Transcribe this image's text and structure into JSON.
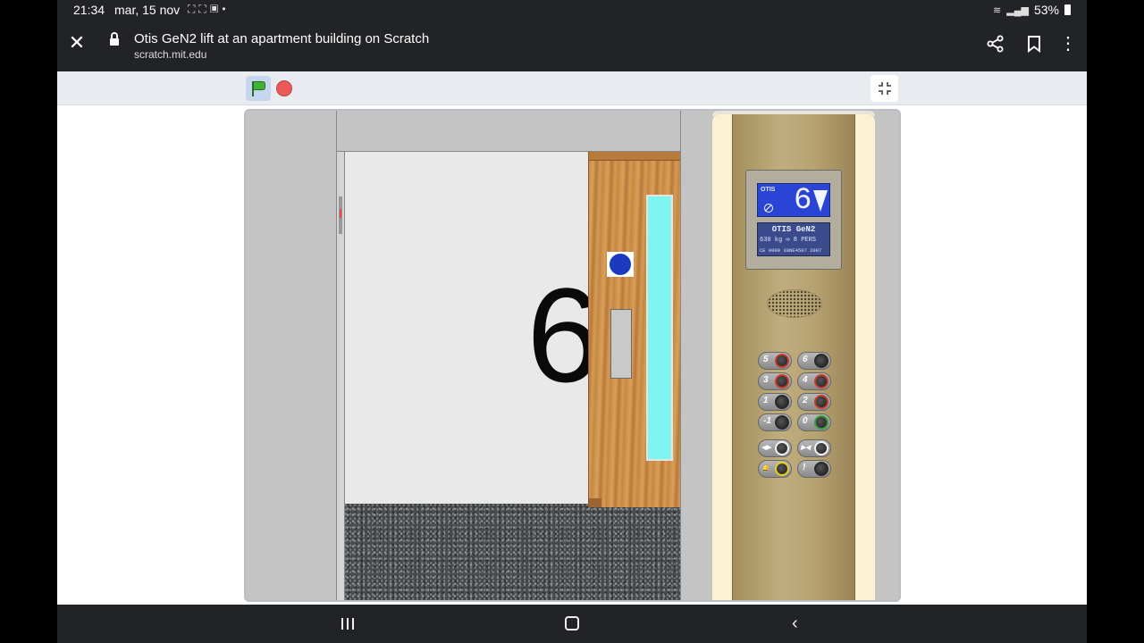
{
  "status_bar": {
    "time": "21:34",
    "date": "mar, 15 nov",
    "left_icons": [
      "screenshot-icon",
      "screen-record-icon",
      "gallery-icon",
      "dot-icon"
    ],
    "battery": "53%"
  },
  "browser": {
    "page_title": "Otis GeN2 lift at an apartment building on Scratch",
    "url": "scratch.mit.edu",
    "icons": [
      "close-icon",
      "lock-icon",
      "share-icon",
      "bookmark-icon",
      "more-vert-icon"
    ]
  },
  "scratch_controls": {
    "icons": [
      "green-flag-icon",
      "stop-icon",
      "exit-fullscreen-icon"
    ]
  },
  "stage": {
    "floor_sign": "6",
    "colors": {
      "door_window": "#7ff5f0",
      "display_bg": "#2a45d6",
      "cop_panel": "#b5a070"
    },
    "display": {
      "brand": "OTIS",
      "floor": "6",
      "direction": "down-arrow-icon",
      "plate_brand": "OTIS GeN2",
      "capacity_line": "630 kg  ∞  8 PERS",
      "code_line": "CE 0000  38NE4507  2007"
    },
    "buttons": [
      {
        "label": "5",
        "ring": "red"
      },
      {
        "label": "6",
        "ring": "dark"
      },
      {
        "label": "3",
        "ring": "red"
      },
      {
        "label": "4",
        "ring": "red"
      },
      {
        "label": "1",
        "ring": "dark"
      },
      {
        "label": "2",
        "ring": "red"
      },
      {
        "label": "-1",
        "ring": "dark"
      },
      {
        "label": "0",
        "ring": "green"
      },
      {
        "label": "◀▶",
        "ring": "white"
      },
      {
        "label": "▶◀",
        "ring": "white"
      },
      {
        "label": "🔔",
        "ring": "yellow"
      },
      {
        "label": "!",
        "ring": "dark"
      }
    ]
  },
  "nav_bar": {
    "icons": [
      "recent-apps-icon",
      "home-icon",
      "back-icon"
    ]
  }
}
